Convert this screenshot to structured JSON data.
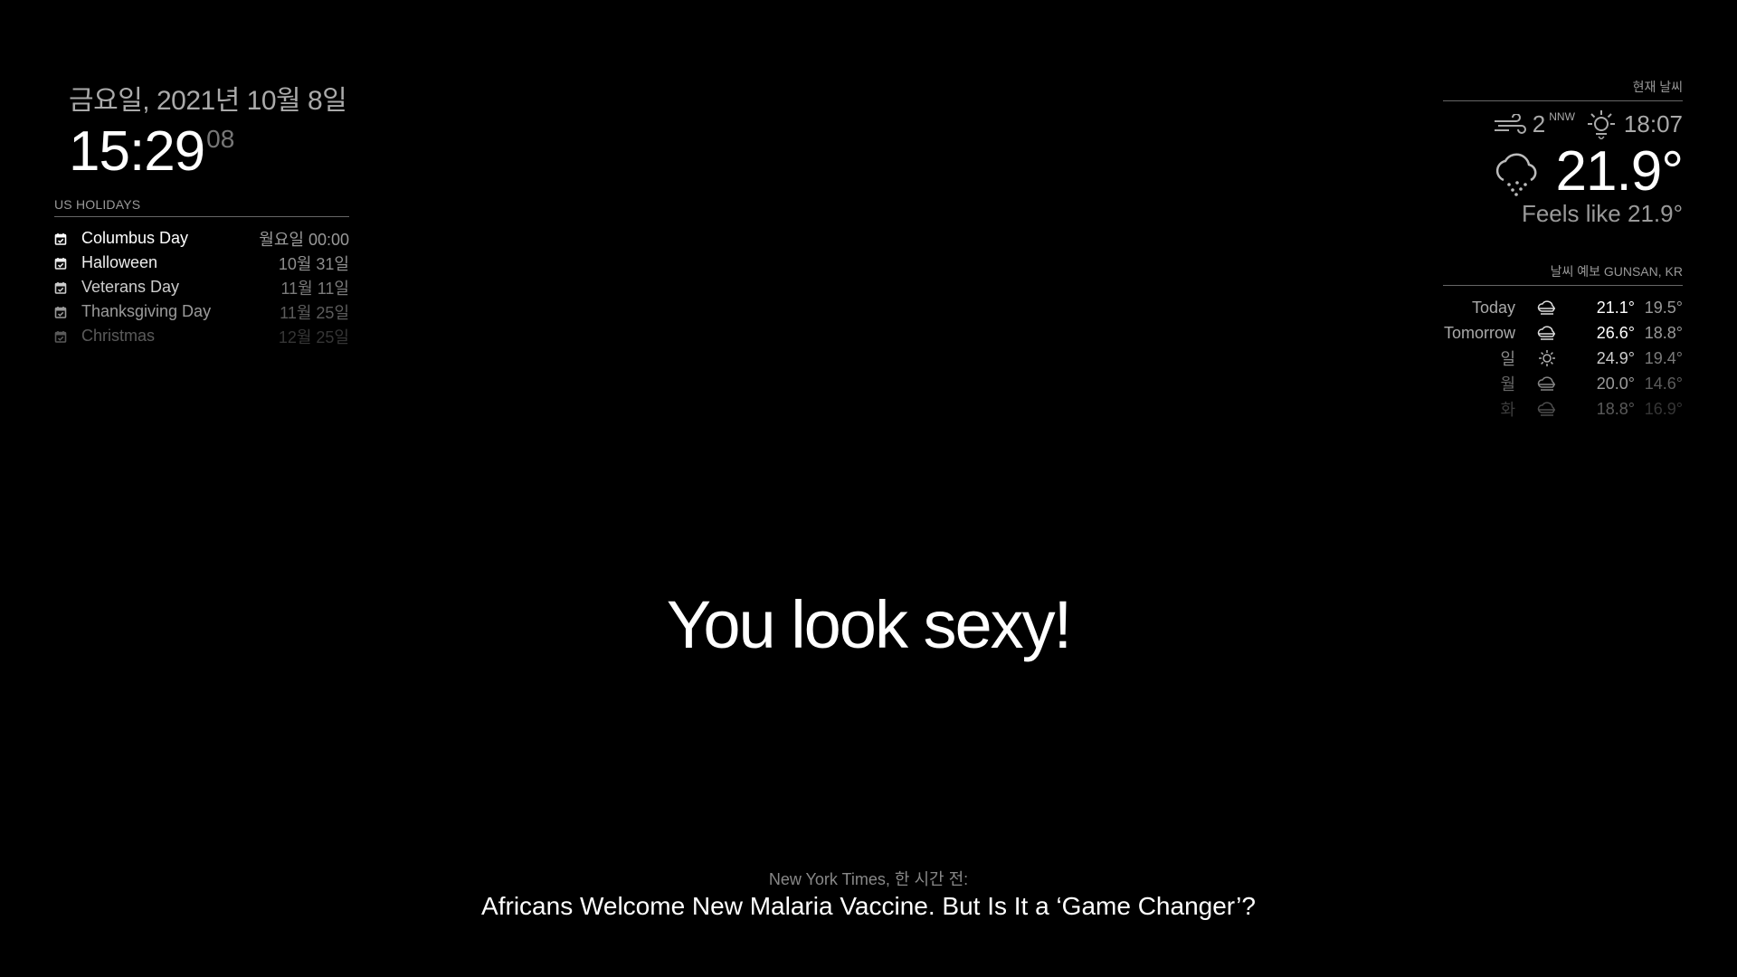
{
  "clock": {
    "date": "금요일, 2021년 10월 8일",
    "time_hm": "15:29",
    "time_sec": "08"
  },
  "holidays": {
    "header": "US HOLIDAYS",
    "items": [
      {
        "title": "Columbus Day",
        "time": "월요일 00:00",
        "opacity": 1.0
      },
      {
        "title": "Halloween",
        "time": "10월 31일",
        "opacity": 0.93
      },
      {
        "title": "Veterans Day",
        "time": "11월 11일",
        "opacity": 0.8
      },
      {
        "title": "Thanksgiving Day",
        "time": "11월 25일",
        "opacity": 0.6
      },
      {
        "title": "Christmas",
        "time": "12월 25일",
        "opacity": 0.35
      }
    ],
    "icon": "calendar-icon"
  },
  "current_weather": {
    "header": "현재 날씨",
    "wind_speed": "2",
    "wind_direction": "NNW",
    "sunset_time": "18:07",
    "temperature": "21.9°",
    "feels_like": "Feels like 21.9°",
    "icons": {
      "wind": "wind-icon",
      "sunset": "sunset-icon",
      "condition": "rain-cloud-icon"
    }
  },
  "forecast": {
    "header": "날씨 예보 GUNSAN, KR",
    "rows": [
      {
        "day": "Today",
        "icon": "cloudy-icon",
        "max": "21.1°",
        "min": "19.5°",
        "opacity": 1.0
      },
      {
        "day": "Tomorrow",
        "icon": "cloudy-icon",
        "max": "26.6°",
        "min": "18.8°",
        "opacity": 1.0
      },
      {
        "day": "일",
        "icon": "sun-icon",
        "max": "24.9°",
        "min": "19.4°",
        "opacity": 0.8
      },
      {
        "day": "월",
        "icon": "cloudy-icon",
        "max": "20.0°",
        "min": "14.6°",
        "opacity": 0.6
      },
      {
        "day": "화",
        "icon": "cloudy-icon",
        "max": "18.8°",
        "min": "16.9°",
        "opacity": 0.35
      }
    ]
  },
  "compliment": {
    "text": "You look sexy!"
  },
  "newsfeed": {
    "source": "New York Times, 한 시간 전:",
    "title": "Africans Welcome New Malaria Vaccine. But Is It a ‘Game Changer’?"
  }
}
